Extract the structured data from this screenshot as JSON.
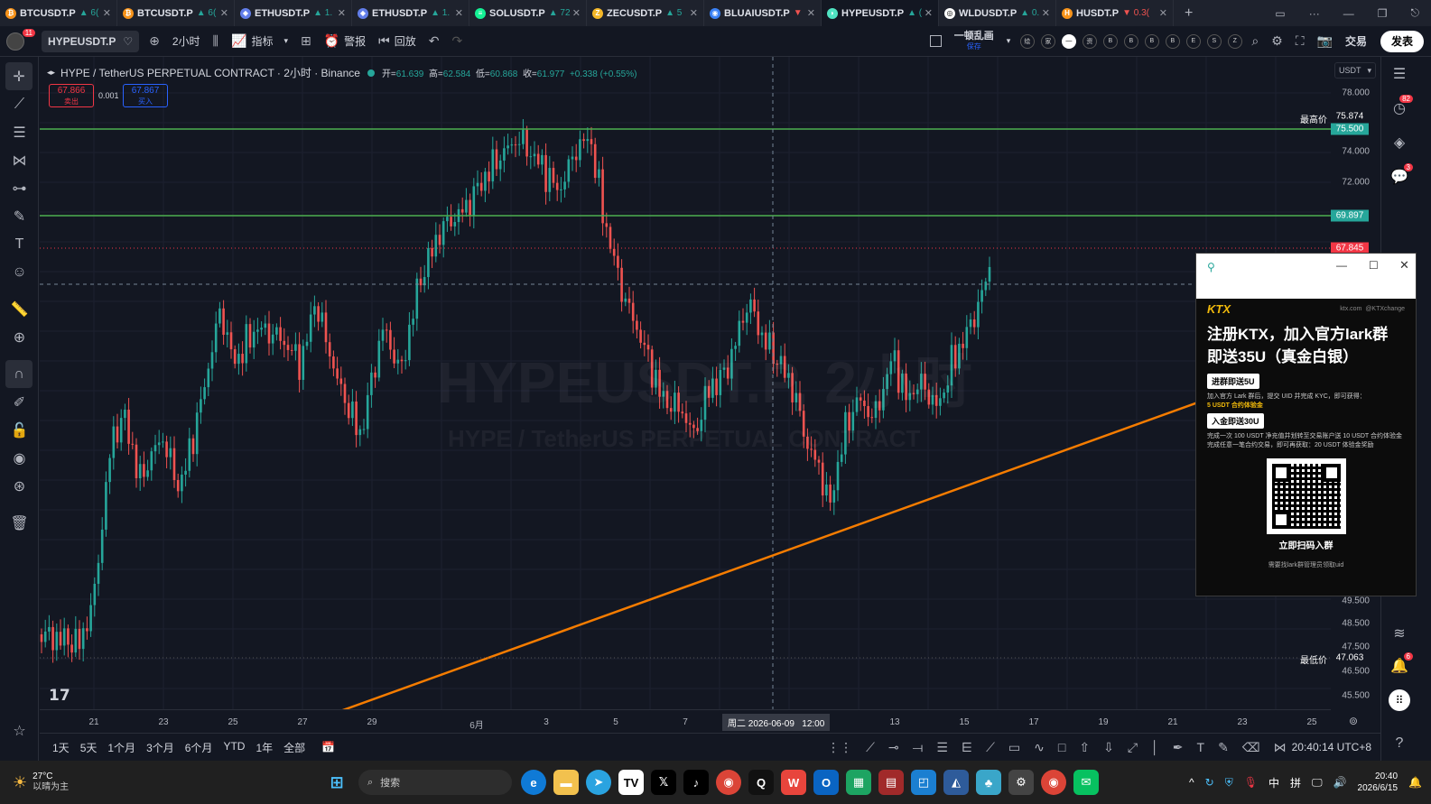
{
  "tabs": [
    {
      "symbol": "BTCUSDT.P",
      "change": "▲ 6(",
      "color": "#f7931a",
      "glyph": "₿",
      "neg": false
    },
    {
      "symbol": "BTCUSDT.P",
      "change": "▲ 6(",
      "color": "#f7931a",
      "glyph": "₿",
      "neg": false
    },
    {
      "symbol": "ETHUSDT.P",
      "change": "▲ 1.",
      "color": "#627eea",
      "glyph": "◆",
      "neg": false
    },
    {
      "symbol": "ETHUSDT.P",
      "change": "▲ 1.",
      "color": "#627eea",
      "glyph": "◆",
      "neg": false
    },
    {
      "symbol": "SOLUSDT.P",
      "change": "▲ 72",
      "color": "#14f195",
      "glyph": "≡",
      "neg": false
    },
    {
      "symbol": "ZECUSDT.P",
      "change": "▲ 5",
      "color": "#f4b728",
      "glyph": "Z",
      "neg": false
    },
    {
      "symbol": "BLUAIUSDT.P",
      "change": "▼",
      "color": "#3b82f6",
      "glyph": "◉",
      "neg": true
    },
    {
      "symbol": "HYPEUSDT.P",
      "change": "▲ (",
      "color": "#50e3c2",
      "glyph": "◗",
      "neg": false,
      "active": true
    },
    {
      "symbol": "WLDUSDT.P",
      "change": "▲ 0.",
      "color": "#ffffff",
      "glyph": "◎",
      "neg": false
    },
    {
      "symbol": "HUSDT.P",
      "change": "▼ 0.3(",
      "color": "#f7931a",
      "glyph": "H",
      "neg": true
    }
  ],
  "toolbar": {
    "notif_badge": "11",
    "symbol": "HYPEUSDT.P",
    "interval": "2小时",
    "indicators": "指标",
    "alert": "警报",
    "replay": "回放",
    "layout_name": "一顿乱画",
    "layout_saved": "保存",
    "trade": "交易",
    "publish": "发表",
    "mini_letters": [
      "绘",
      "家",
      "—",
      "资",
      "B",
      "B",
      "B",
      "B",
      "E",
      "S",
      "Z"
    ]
  },
  "legend": {
    "title": "HYPE / TetherUS PERPETUAL CONTRACT · 2小时 · Binance",
    "open_label": "开=",
    "open": "61.639",
    "high_label": "高=",
    "high": "62.584",
    "low_label": "低=",
    "low": "60.868",
    "close_label": "收=",
    "close": "61.977",
    "change": "+0.338 (+0.55%)"
  },
  "order": {
    "sell_price": "67.866",
    "sell_label": "卖出",
    "spread": "0.001",
    "buy_price": "67.867",
    "buy_label": "买入"
  },
  "watermark": {
    "line1": "HYPEUSDT.P, 2小时",
    "line2": "HYPE / TetherUS PERPETUAL CONTRACT"
  },
  "price_scale": {
    "currency": "USDT",
    "ticks": [
      "78.000",
      "74.000",
      "72.000",
      "49.500",
      "48.500",
      "47.500",
      "46.500",
      "45.500"
    ],
    "high_label": "最高价",
    "high_value": "75.874",
    "line1_value": "75.500",
    "line2_value": "69.897",
    "current_value": "67.845",
    "low_label": "最低价",
    "low_value": "47.063"
  },
  "time_scale": {
    "labels": [
      "21",
      "23",
      "25",
      "27",
      "29",
      "6月",
      "3",
      "5",
      "7",
      "13",
      "15",
      "17",
      "19",
      "21",
      "23",
      "25"
    ],
    "crosshair": "周二 2026-06-09   12:00"
  },
  "bottom": {
    "ranges": [
      "1天",
      "5天",
      "1个月",
      "3个月",
      "6个月",
      "YTD",
      "1年",
      "全部"
    ],
    "clock": "20:40:14 UTC+8"
  },
  "popup": {
    "brand": "KTX",
    "site": "ktx.com",
    "handle": "@KTXchange",
    "headline1": "注册KTX，加入官方lark群",
    "headline2": "即送35U（真金白银）",
    "badge1": "进群即送5U",
    "text1": "加入官方 Lark 群后，提交 UID 并完成 KYC，即可获得：",
    "text1b": "5 USDT 合约体验金",
    "badge2": "入金即送30U",
    "text2": "完成一次 100 USDT 净充值并划转至交易账户送 10 USDT 合约体验金",
    "text3": "完成任意一笔合约交易，即可再获取：20 USDT 体验金奖励",
    "qr_caption": "立即扫码入群",
    "footer": "需要找lark群管理员领取uid"
  },
  "taskbar": {
    "weather_temp": "27°C",
    "weather_desc": "以晴为主",
    "search": "搜索",
    "time": "20:40",
    "date": "2026/6/15",
    "ime1": "中",
    "ime2": "拼"
  },
  "right_badges": [
    "82",
    "3",
    "6"
  ],
  "chart_data": {
    "type": "candlestick",
    "series_description": "HYPEUSDT.P 2h candles",
    "ylim": [
      45.0,
      79.0
    ],
    "horizontal_lines": [
      75.5,
      69.897
    ],
    "trendline": {
      "from": {
        "x": "05-29",
        "y": 44.9
      },
      "to": {
        "x": "06-17",
        "y": 58.5
      }
    },
    "last_price": 67.845,
    "key_points": [
      {
        "x": "05-20",
        "y": 47.5
      },
      {
        "x": "05-22",
        "y": 57.5
      },
      {
        "x": "05-24",
        "y": 60.5
      },
      {
        "x": "05-26",
        "y": 62.0
      },
      {
        "x": "05-28",
        "y": 58.0
      },
      {
        "x": "05-30",
        "y": 66.0
      },
      {
        "x": "06-01",
        "y": 75.8
      },
      {
        "x": "06-04",
        "y": 75.4
      },
      {
        "x": "06-05",
        "y": 63.0
      },
      {
        "x": "06-07",
        "y": 58.5
      },
      {
        "x": "06-09",
        "y": 64.0
      },
      {
        "x": "06-11",
        "y": 54.5
      },
      {
        "x": "06-13",
        "y": 60.0
      },
      {
        "x": "06-15",
        "y": 61.0
      },
      {
        "x": "06-16",
        "y": 67.8
      }
    ]
  }
}
